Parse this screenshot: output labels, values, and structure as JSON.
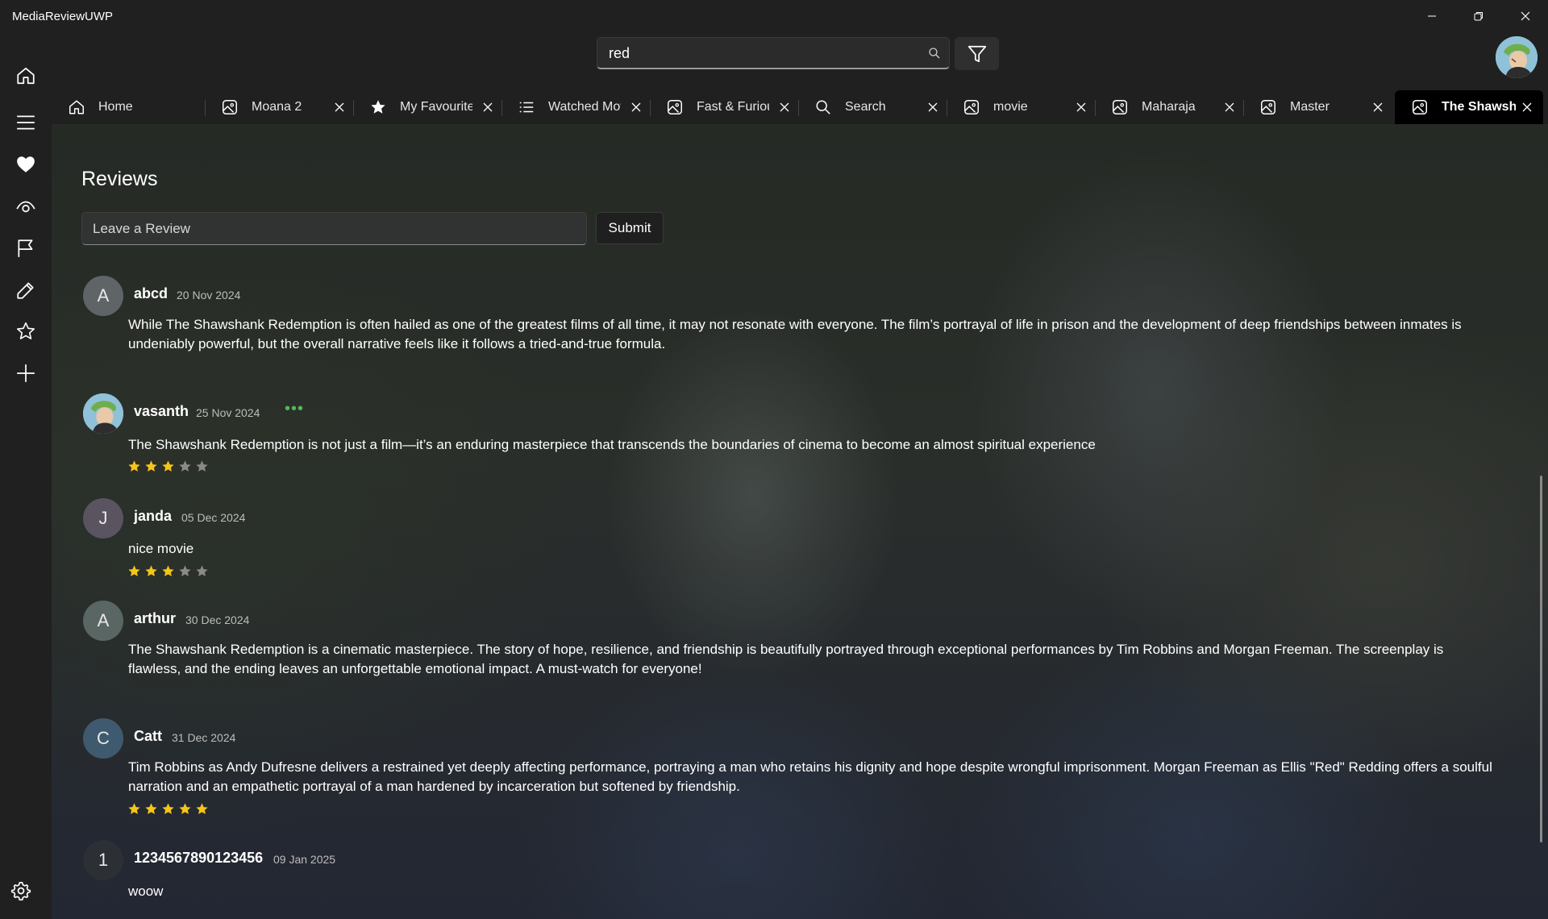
{
  "app": {
    "title": "MediaReviewUWP"
  },
  "search": {
    "value": "red"
  },
  "rail": {
    "items": [
      "home-icon",
      "menu-icon",
      "heart-icon",
      "eye-icon",
      "flag-icon",
      "pencil-icon",
      "star-icon",
      "add-icon"
    ],
    "settings_icon": "gear-icon"
  },
  "tabs": [
    {
      "label": "Home",
      "icon": "home-icon",
      "closable": false
    },
    {
      "label": "Moana 2",
      "icon": "image-icon",
      "closable": true
    },
    {
      "label": "My Favourites",
      "icon": "star-icon",
      "closable": true
    },
    {
      "label": "Watched Movies",
      "icon": "list-icon",
      "closable": true
    },
    {
      "label": "Fast & Furious",
      "icon": "image-icon",
      "closable": true
    },
    {
      "label": "Search",
      "icon": "search-icon",
      "closable": true
    },
    {
      "label": "movie",
      "icon": "image-icon",
      "closable": true
    },
    {
      "label": "Maharaja",
      "icon": "image-icon",
      "closable": true
    },
    {
      "label": "Master",
      "icon": "image-icon",
      "closable": true
    },
    {
      "label": "The Shawshank Redemption",
      "icon": "image-icon",
      "closable": true,
      "active": true
    }
  ],
  "reviews_section": {
    "title": "Reviews",
    "input_placeholder": "Leave a Review",
    "submit_label": "Submit"
  },
  "reviews": [
    {
      "initial": "A",
      "avatar_color": "#5f6466",
      "name": "abcd",
      "date": "20 Nov 2024",
      "text": "While The Shawshank Redemption is often hailed as one of the greatest films of all time, it may not resonate with everyone. The film’s portrayal of life in prison and the development of deep friendships between inmates is undeniably powerful, but the overall narrative feels like it follows a tried-and-true formula.",
      "rating": null
    },
    {
      "initial": "",
      "avatar_color": "#8fc2d8",
      "name": "vasanth",
      "date": "25 Nov 2024",
      "more": "•••",
      "text": "The Shawshank Redemption is not just a film—it’s an enduring masterpiece that transcends the boundaries of cinema to become an almost spiritual experience",
      "rating": 3
    },
    {
      "initial": "J",
      "avatar_color": "#5a5360",
      "name": "janda",
      "date": "05 Dec 2024",
      "text": "nice movie",
      "rating": 3
    },
    {
      "initial": "A",
      "avatar_color": "#596663",
      "name": "arthur",
      "date": "30 Dec 2024",
      "text": "The Shawshank Redemption is a cinematic masterpiece. The story of hope, resilience, and friendship is beautifully portrayed through exceptional performances by Tim Robbins and Morgan Freeman. The screenplay is flawless, and the ending leaves an unforgettable emotional impact. A must-watch for everyone!",
      "rating": null
    },
    {
      "initial": "C",
      "avatar_color": "#3f5a6e",
      "name": "Catt",
      "date": "31 Dec 2024",
      "text": "Tim Robbins as Andy Dufresne delivers a restrained yet deeply affecting performance, portraying a man who retains his dignity and hope despite wrongful imprisonment. Morgan Freeman as Ellis \"Red\" Redding offers a soulful narration and an empathetic portrayal of a man hardened by incarceration but softened by friendship.",
      "rating": 5
    },
    {
      "initial": "1",
      "avatar_color": "#2c2f33",
      "name": "1234567890123456",
      "date": "09 Jan 2025",
      "text": "woow",
      "rating": null
    }
  ],
  "colors": {
    "star_filled": "#f5c518",
    "star_empty": "#8a8a8a",
    "more_dots": "#55b55a",
    "active_tab": "#000000"
  }
}
